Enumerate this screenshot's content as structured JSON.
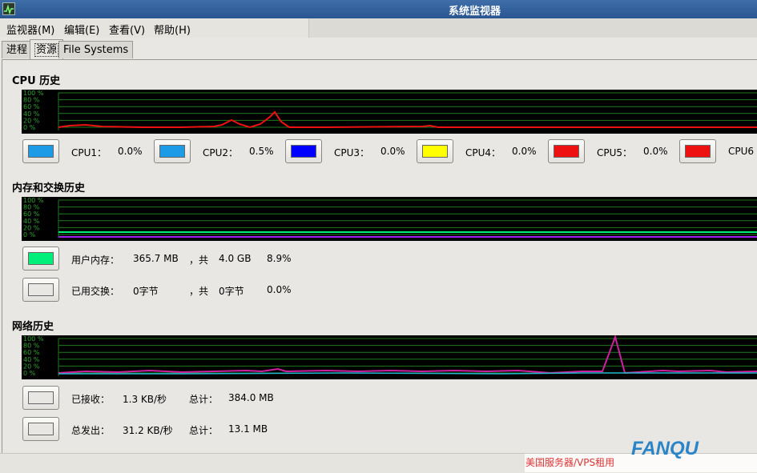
{
  "window": {
    "title": "系统监视器"
  },
  "menu": [
    "监视器(M)",
    "编辑(E)",
    "查看(V)",
    "帮助(H)"
  ],
  "tabs": [
    "进程",
    "资源",
    "File Systems"
  ],
  "cpu": {
    "title": "CPU 历史",
    "graph_ticks": [
      "100 %",
      "80 %",
      "60 %",
      "40 %",
      "20 %",
      "0 %"
    ],
    "cores": [
      {
        "label": "CPU1：",
        "value": "0.0%",
        "color": "#1e9be6"
      },
      {
        "label": "CPU2：",
        "value": "0.5%",
        "color": "#1e9be6"
      },
      {
        "label": "CPU3：",
        "value": "0.0%",
        "color": "#0000ff"
      },
      {
        "label": "CPU4：",
        "value": "0.0%",
        "color": "#ffff00"
      },
      {
        "label": "CPU5：",
        "value": "0.0%",
        "color": "#ee1111"
      },
      {
        "label": "CPU6",
        "value": "",
        "color": "#ee1111"
      }
    ]
  },
  "memory": {
    "title": "内存和交换历史",
    "graph_ticks": [
      "100 %",
      "80 %",
      "60 %",
      "40 %",
      "20 %",
      "0 %"
    ],
    "user_memory": {
      "label": "用户内存：",
      "used": "365.7 MB",
      "total_label": "，共",
      "total": "4.0 GB",
      "percent": "8.9%",
      "color": "#00ee7a"
    },
    "swap": {
      "label": "已用交换：",
      "used": "0字节",
      "total_label": "，共",
      "total": "0字节",
      "percent": "0.0%",
      "color": "#e9e7e3"
    }
  },
  "network": {
    "title": "网络历史",
    "graph_ticks": [
      "100 %",
      "80 %",
      "60 %",
      "40 %",
      "20 %",
      "0 %"
    ],
    "received": {
      "label": "已接收：",
      "rate": "1.3 KB/秒",
      "total_label": "总计：",
      "total": "384.0 MB"
    },
    "sent": {
      "label": "总发出：",
      "rate": "31.2 KB/秒",
      "total_label": "总计：",
      "total": "13.1 MB"
    }
  },
  "watermark": {
    "text": "美国服务器/VPS租用",
    "logo": "FANQU"
  }
}
